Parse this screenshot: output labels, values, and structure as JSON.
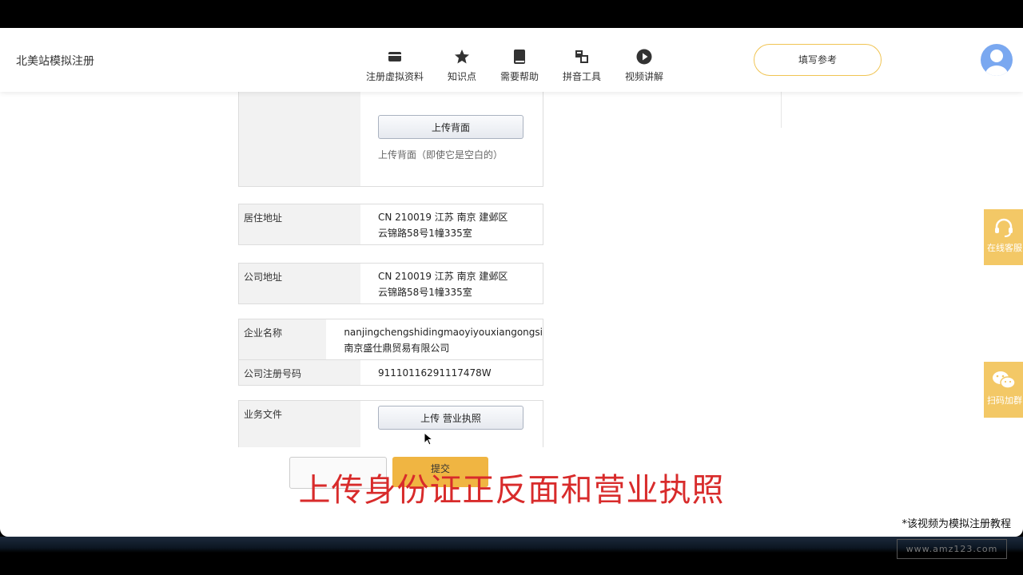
{
  "header": {
    "site_title": "北美站模拟注册",
    "nav": [
      {
        "label": "注册虚拟资料",
        "icon": "card-icon"
      },
      {
        "label": "知识点",
        "icon": "star-icon"
      },
      {
        "label": "需要帮助",
        "icon": "book-icon"
      },
      {
        "label": "拼音工具",
        "icon": "translate-icon"
      },
      {
        "label": "视频讲解",
        "icon": "play-icon"
      }
    ],
    "reference_button": "填写参考"
  },
  "form": {
    "id_back": {
      "button": "上传背面",
      "note": "上传背面（即使它是空白的）"
    },
    "residence": {
      "label": "居住地址",
      "line1": "CN 210019 江苏 南京 建邺区",
      "line2": "云锦路58号1幢335室"
    },
    "company_address": {
      "label": "公司地址",
      "line1": "CN 210019 江苏 南京 建邺区",
      "line2": "云锦路58号1幢335室"
    },
    "company_name": {
      "label": "企业名称",
      "line1": "nanjingchengshidingmaoyiyouxiangongsi",
      "line2": "南京盛仕鼎贸易有限公司"
    },
    "registration_number": {
      "label": "公司注册号码",
      "value": "91110116291117478W"
    },
    "business_docs": {
      "label": "业务文件",
      "button": "上传 营业执照"
    },
    "submit_label": "提交"
  },
  "subtitle": "上传身份证正反面和营业执照",
  "disclaimer": "*该视频为模拟注册教程",
  "float": {
    "online_label": "在线客服",
    "wechat_label": "扫码加群"
  },
  "watermark": "www.amz123.com",
  "colors": {
    "accent": "#f3c866",
    "subtitle": "#d82b2b",
    "reference_border": "#f0c453"
  }
}
